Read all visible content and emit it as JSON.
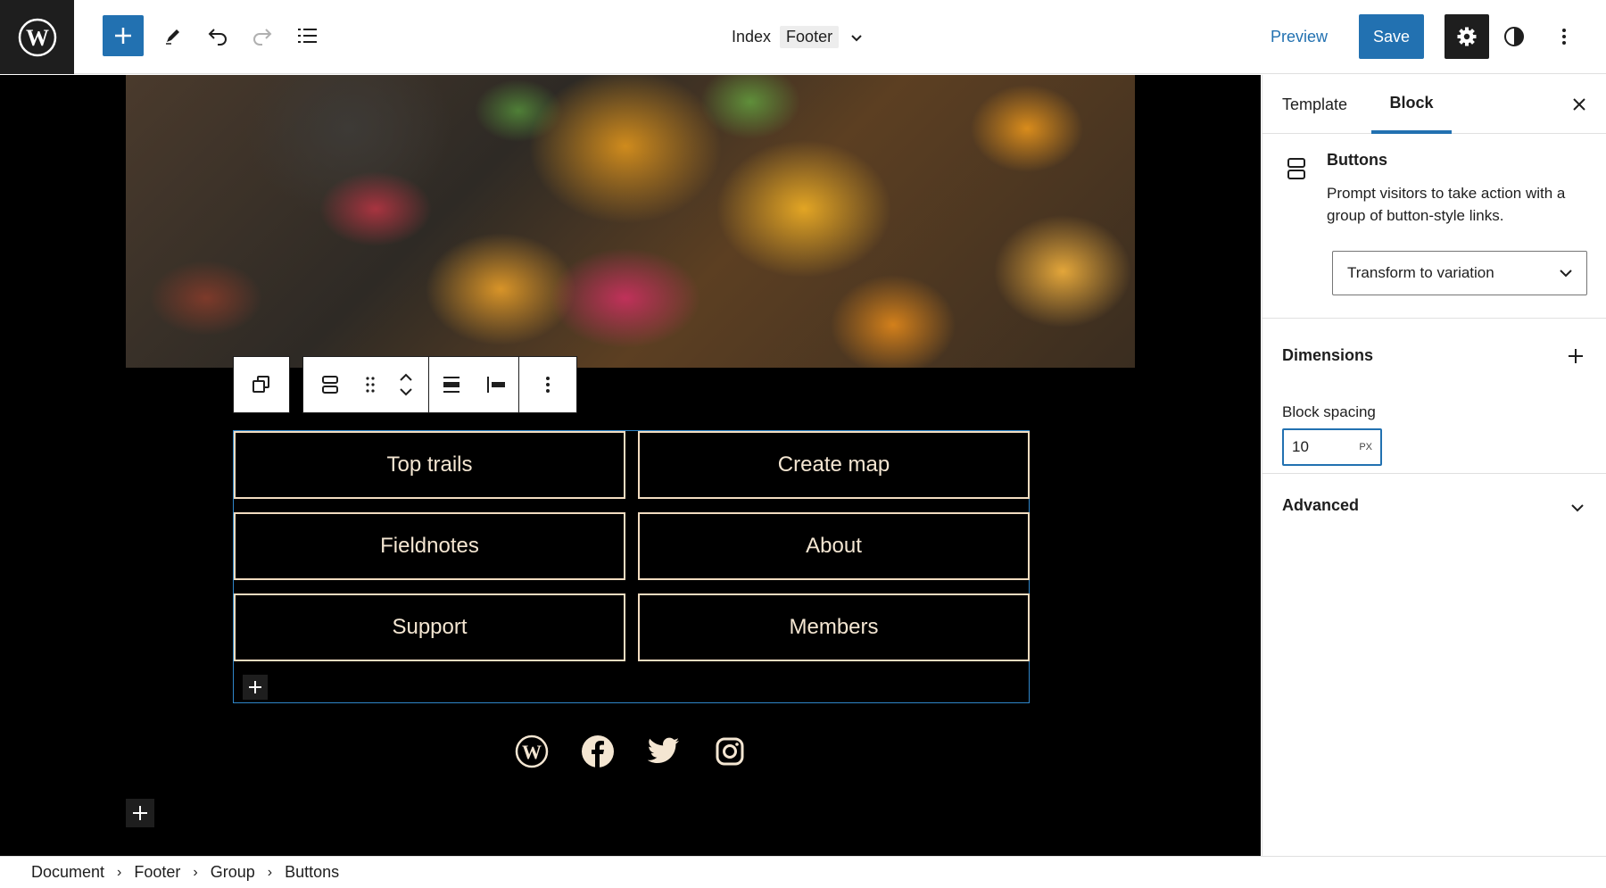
{
  "header": {
    "doc_title": "Index",
    "doc_tag": "Footer",
    "preview_label": "Preview",
    "save_label": "Save"
  },
  "canvas": {
    "buttons": [
      {
        "label": "Top trails"
      },
      {
        "label": "Create map"
      },
      {
        "label": "Fieldnotes"
      },
      {
        "label": "About"
      },
      {
        "label": "Support"
      },
      {
        "label": "Members"
      }
    ],
    "social_icons": [
      "wordpress-icon",
      "facebook-icon",
      "twitter-icon",
      "instagram-icon"
    ]
  },
  "sidebar": {
    "tabs": [
      {
        "label": "Template",
        "active": false
      },
      {
        "label": "Block",
        "active": true
      }
    ],
    "block": {
      "title": "Buttons",
      "description": "Prompt visitors to take action with a group of button-style links.",
      "transform_label": "Transform to variation"
    },
    "dimensions": {
      "title": "Dimensions",
      "spacing_label": "Block spacing",
      "spacing_value": "10",
      "spacing_unit": "PX"
    },
    "advanced": {
      "title": "Advanced"
    }
  },
  "breadcrumb": {
    "items": [
      "Document",
      "Footer",
      "Group",
      "Buttons"
    ]
  },
  "colors": {
    "accent": "#2271b1",
    "dark": "#1e1e1e",
    "button_border": "#f2dcc0"
  }
}
